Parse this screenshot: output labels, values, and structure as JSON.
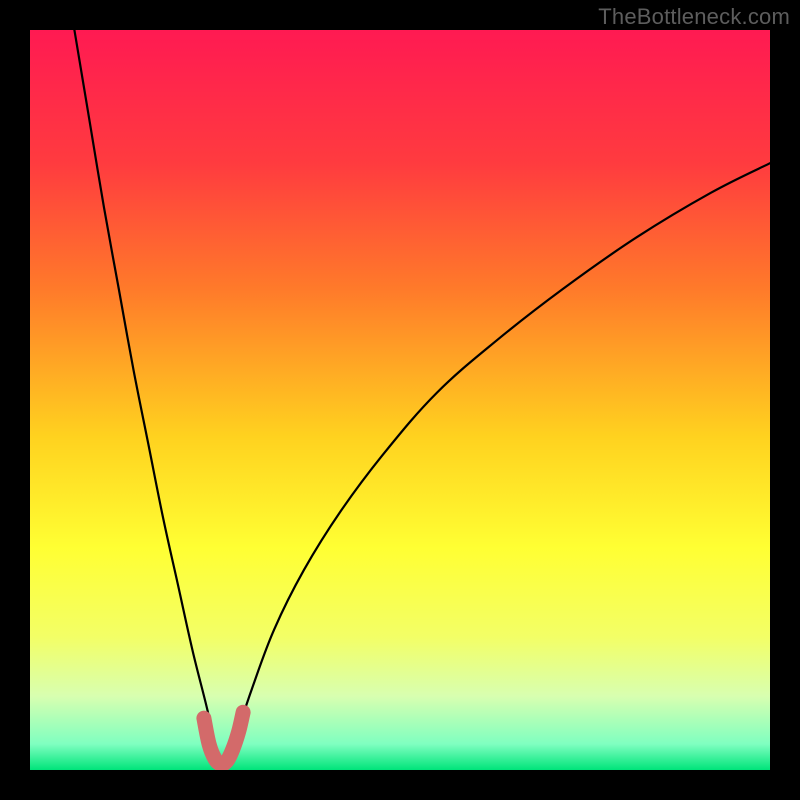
{
  "watermark": {
    "text": "TheBottleneck.com"
  },
  "colors": {
    "gradient_stops": [
      {
        "pos": 0.0,
        "color": "#ff1a52"
      },
      {
        "pos": 0.18,
        "color": "#ff3b3f"
      },
      {
        "pos": 0.35,
        "color": "#ff7a2a"
      },
      {
        "pos": 0.55,
        "color": "#ffd21f"
      },
      {
        "pos": 0.7,
        "color": "#ffff33"
      },
      {
        "pos": 0.82,
        "color": "#f3ff66"
      },
      {
        "pos": 0.9,
        "color": "#d8ffb0"
      },
      {
        "pos": 0.965,
        "color": "#7fffc0"
      },
      {
        "pos": 1.0,
        "color": "#00e47a"
      }
    ],
    "curve": "#000000",
    "highlight": "#d36a6a"
  },
  "chart_data": {
    "type": "line",
    "title": "",
    "xlabel": "",
    "ylabel": "",
    "xlim": [
      0,
      100
    ],
    "ylim": [
      0,
      100
    ],
    "series": [
      {
        "name": "bottleneck-curve",
        "x": [
          6,
          8,
          10,
          12,
          14,
          16,
          18,
          20,
          22,
          24,
          25,
          26,
          27,
          28,
          30,
          33,
          37,
          42,
          48,
          55,
          63,
          72,
          82,
          92,
          100
        ],
        "y": [
          100,
          88,
          76,
          65,
          54,
          44,
          34,
          25,
          16,
          8,
          3,
          1,
          2,
          5,
          11,
          19,
          27,
          35,
          43,
          51,
          58,
          65,
          72,
          78,
          82
        ]
      },
      {
        "name": "optimal-zone-highlight",
        "x": [
          23.5,
          24.2,
          25.0,
          25.8,
          26.6,
          27.4,
          28.2,
          28.8
        ],
        "y": [
          7.0,
          3.5,
          1.5,
          0.8,
          1.2,
          2.8,
          5.2,
          7.8
        ]
      }
    ],
    "annotations": []
  }
}
